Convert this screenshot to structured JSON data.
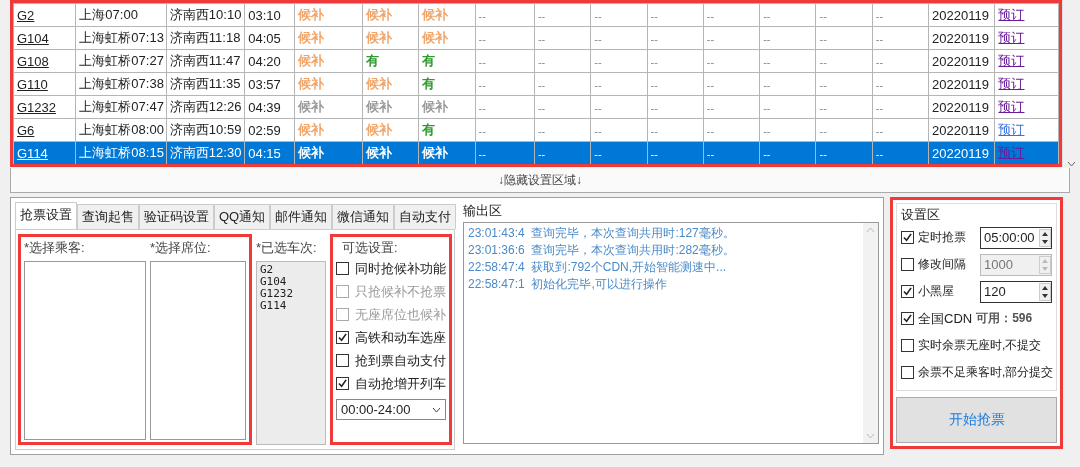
{
  "trains": [
    {
      "train": "G2",
      "from": "上海07:00",
      "to": "济南西10:10",
      "duration": "03:10",
      "seats": [
        {
          "text": "候补",
          "color": "#f0a468"
        },
        {
          "text": "候补",
          "color": "#f0a468"
        },
        {
          "text": "候补",
          "color": "#f0a468"
        }
      ],
      "others": [
        "--",
        "--",
        "--",
        "--",
        "--",
        "--",
        "--",
        "--"
      ],
      "date": "20220119",
      "book": {
        "text": "预订",
        "visited": true
      },
      "selected": false
    },
    {
      "train": "G104",
      "from": "上海虹桥07:13",
      "to": "济南西11:18",
      "duration": "04:05",
      "seats": [
        {
          "text": "候补",
          "color": "#f0a468"
        },
        {
          "text": "候补",
          "color": "#f0a468"
        },
        {
          "text": "候补",
          "color": "#f0a468"
        }
      ],
      "others": [
        "--",
        "--",
        "--",
        "--",
        "--",
        "--",
        "--",
        "--"
      ],
      "date": "20220119",
      "book": {
        "text": "预订",
        "visited": true
      },
      "selected": false
    },
    {
      "train": "G108",
      "from": "上海虹桥07:27",
      "to": "济南西11:47",
      "duration": "04:20",
      "seats": [
        {
          "text": "候补",
          "color": "#f0a468"
        },
        {
          "text": "有",
          "color": "#2e9b2e"
        },
        {
          "text": "有",
          "color": "#2e9b2e"
        }
      ],
      "others": [
        "--",
        "--",
        "--",
        "--",
        "--",
        "--",
        "--",
        "--"
      ],
      "date": "20220119",
      "book": {
        "text": "预订",
        "visited": true
      },
      "selected": false
    },
    {
      "train": "G110",
      "from": "上海虹桥07:38",
      "to": "济南西11:35",
      "duration": "03:57",
      "seats": [
        {
          "text": "候补",
          "color": "#f0a468"
        },
        {
          "text": "候补",
          "color": "#f0a468"
        },
        {
          "text": "有",
          "color": "#2e9b2e"
        }
      ],
      "others": [
        "--",
        "--",
        "--",
        "--",
        "--",
        "--",
        "--",
        "--"
      ],
      "date": "20220119",
      "book": {
        "text": "预订",
        "visited": true
      },
      "selected": false
    },
    {
      "train": "G1232",
      "from": "上海虹桥07:47",
      "to": "济南西12:26",
      "duration": "04:39",
      "seats": [
        {
          "text": "候补",
          "color": "#999999"
        },
        {
          "text": "候补",
          "color": "#999999"
        },
        {
          "text": "候补",
          "color": "#999999"
        }
      ],
      "others": [
        "--",
        "--",
        "--",
        "--",
        "--",
        "--",
        "--",
        "--"
      ],
      "date": "20220119",
      "book": {
        "text": "预订",
        "visited": true
      },
      "selected": false
    },
    {
      "train": "G6",
      "from": "上海虹桥08:00",
      "to": "济南西10:59",
      "duration": "02:59",
      "seats": [
        {
          "text": "候补",
          "color": "#f0a468"
        },
        {
          "text": "候补",
          "color": "#f0a468"
        },
        {
          "text": "有",
          "color": "#2e9b2e"
        }
      ],
      "others": [
        "--",
        "--",
        "--",
        "--",
        "--",
        "--",
        "--",
        "--"
      ],
      "date": "20220119",
      "book": {
        "text": "预订",
        "visited": false
      },
      "selected": false
    },
    {
      "train": "G114",
      "from": "上海虹桥08:15",
      "to": "济南西12:30",
      "duration": "04:15",
      "seats": [
        {
          "text": "候补"
        },
        {
          "text": "候补"
        },
        {
          "text": "候补"
        }
      ],
      "others": [
        "--",
        "--",
        "--",
        "--",
        "--",
        "--",
        "--",
        "--"
      ],
      "date": "20220119",
      "book": {
        "text": "预订",
        "visited": true
      },
      "selected": true
    }
  ],
  "toggle_bar": "↓隐藏设置区域↓",
  "tabs": [
    {
      "label": "抢票设置",
      "selected": true
    },
    {
      "label": "查询起售",
      "selected": false
    },
    {
      "label": "验证码设置",
      "selected": false
    },
    {
      "label": "QQ通知",
      "selected": false
    },
    {
      "label": "邮件通知",
      "selected": false
    },
    {
      "label": "微信通知",
      "selected": false
    },
    {
      "label": "自动支付",
      "selected": false
    }
  ],
  "passengers": {
    "label": "*选择乘客:"
  },
  "seat_types": {
    "label": "*选择席位:"
  },
  "selected_trains": {
    "label": "*已选车次:",
    "items": [
      "G2",
      "G104",
      "G1232",
      "G114"
    ]
  },
  "options": {
    "label": "可选设置:",
    "items": [
      {
        "label": "同时抢候补功能",
        "checked": false,
        "disabled": false
      },
      {
        "label": "只抢候补不抢票",
        "checked": false,
        "disabled": true
      },
      {
        "label": "无座席位也候补",
        "checked": false,
        "disabled": true
      },
      {
        "label": "高铁和动车选座",
        "checked": true,
        "disabled": false
      },
      {
        "label": "抢到票自动支付",
        "checked": false,
        "disabled": false
      },
      {
        "label": "自动抢增开列车",
        "checked": true,
        "disabled": false
      }
    ],
    "time_range": "00:00-24:00"
  },
  "output": {
    "title": "输出区",
    "lines": [
      {
        "time": "23:01:43:4",
        "text": "查询完毕，本次查询共用时:127毫秒。"
      },
      {
        "time": "23:01:36:6",
        "text": "查询完毕，本次查询共用时:282毫秒。"
      },
      {
        "time": "22:58:47:4",
        "text": "获取到:792个CDN,开始智能测速中..."
      },
      {
        "time": "22:58:47:1",
        "text": "初始化完毕,可以进行操作"
      }
    ]
  },
  "settings": {
    "title": "设置区",
    "items": [
      {
        "kind": "spin",
        "label": "定时抢票",
        "checked": true,
        "value": "05:00:00",
        "disabled": false
      },
      {
        "kind": "spin",
        "label": "修改间隔",
        "checked": false,
        "value": "1000",
        "disabled": true
      },
      {
        "kind": "spin",
        "label": "小黑屋",
        "checked": true,
        "value": "120",
        "disabled": false
      },
      {
        "kind": "note",
        "label": "全国CDN",
        "checked": true,
        "note": "可用：596"
      },
      {
        "kind": "check",
        "label": "实时余票无座时,不提交",
        "checked": false
      },
      {
        "kind": "check",
        "label": "余票不足乘客时,部分提交",
        "checked": false
      }
    ],
    "start_button": "开始抢票"
  }
}
